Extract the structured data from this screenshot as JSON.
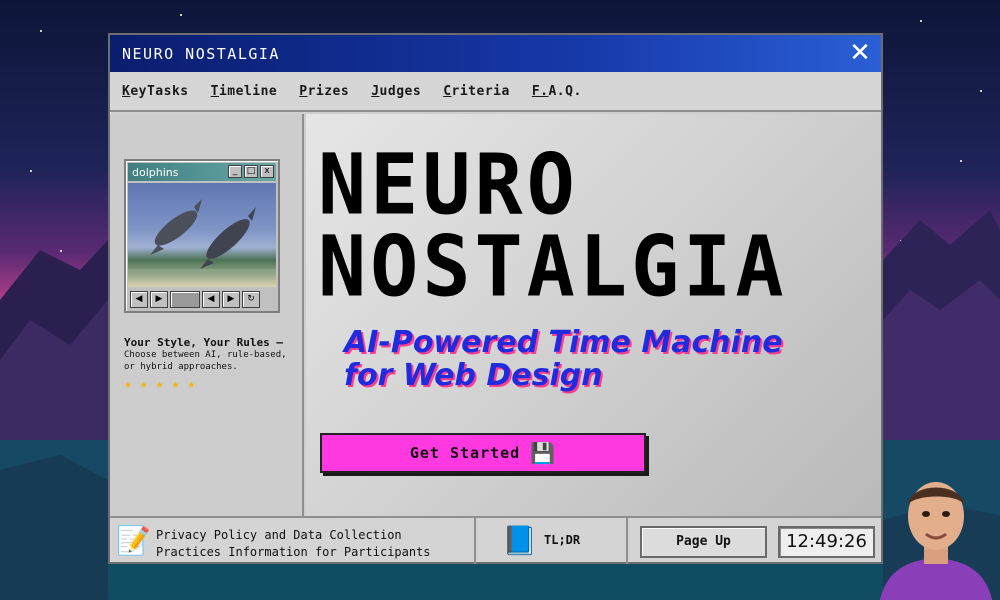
{
  "window": {
    "title": "NEURO NOSTALGIA",
    "close_glyph": "✕"
  },
  "menu": {
    "items": [
      {
        "label": "KeyTasks"
      },
      {
        "label": "Timeline"
      },
      {
        "label": "Prizes"
      },
      {
        "label": "Judges"
      },
      {
        "label": "Criteria"
      },
      {
        "label": "F.A.Q."
      }
    ]
  },
  "sidebar": {
    "player": {
      "title": "dolphins",
      "minimize": "_",
      "maximize": "□",
      "close": "x"
    },
    "blurb": {
      "heading": "Your Style, Your Rules –",
      "body": "Choose between AI, rule-based, or hybrid approaches."
    },
    "stars": {
      "count": 5,
      "max": 5,
      "glyph": "★"
    }
  },
  "hero": {
    "title_line1": "NEURO",
    "title_line2": "NOSTALGIA",
    "subtitle_line1": "AI-Powered Time Machine",
    "subtitle_line2": "for Web Design",
    "cta_label": "Get Started",
    "cta_icon": "floppy-disk-icon"
  },
  "statusbar": {
    "privacy_line1": "Privacy Policy and Data Collection",
    "privacy_line2": "Practices Information for Participants",
    "privacy_icon": "notepad-icon",
    "help_label": "TL;DR",
    "help_icon": "help-book-icon",
    "page_up": "Page Up",
    "clock": "12:49:26"
  },
  "colors": {
    "titlebar": "#1638a8",
    "accent_pink": "#ff38e0",
    "subtitle_blue": "#1f2bdc"
  }
}
